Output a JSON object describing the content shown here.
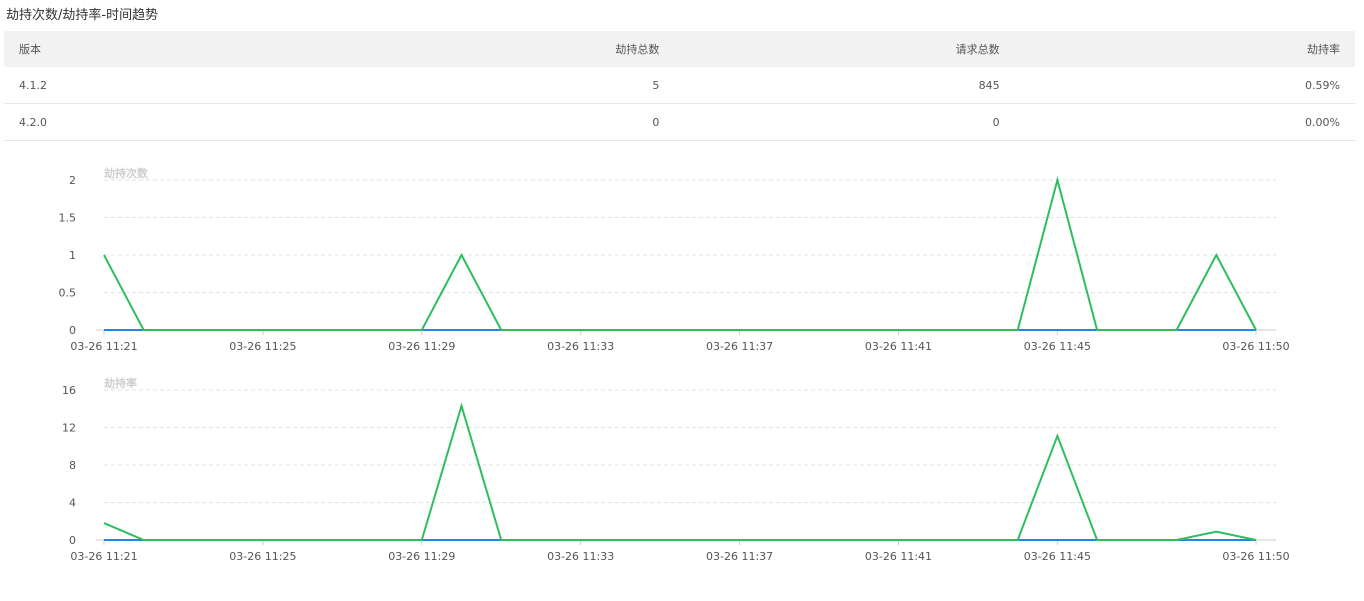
{
  "page": {
    "title": "劫持次数/劫持率-时间趋势"
  },
  "table": {
    "headers": [
      "版本",
      "劫持总数",
      "请求总数",
      "劫持率"
    ],
    "rows": [
      [
        "4.1.2",
        "5",
        "845",
        "0.59%"
      ],
      [
        "4.2.0",
        "0",
        "0",
        "0.00%"
      ]
    ]
  },
  "colors": {
    "green": "#2dbe60",
    "blue": "#1e88e5",
    "grid": "#e0e0e0",
    "axis": "#cccccc"
  },
  "chart_data": [
    {
      "type": "line",
      "title": "劫持次数",
      "x": [
        "03-26 11:21",
        "03-26 11:22",
        "03-26 11:23",
        "03-26 11:24",
        "03-26 11:25",
        "03-26 11:26",
        "03-26 11:27",
        "03-26 11:28",
        "03-26 11:29",
        "03-26 11:30",
        "03-26 11:31",
        "03-26 11:32",
        "03-26 11:33",
        "03-26 11:34",
        "03-26 11:35",
        "03-26 11:36",
        "03-26 11:37",
        "03-26 11:38",
        "03-26 11:39",
        "03-26 11:40",
        "03-26 11:41",
        "03-26 11:42",
        "03-26 11:43",
        "03-26 11:44",
        "03-26 11:45",
        "03-26 11:46",
        "03-26 11:47",
        "03-26 11:48",
        "03-26 11:49",
        "03-26 11:50"
      ],
      "x_ticks": [
        "03-26 11:21",
        "03-26 11:25",
        "03-26 11:29",
        "03-26 11:33",
        "03-26 11:37",
        "03-26 11:41",
        "03-26 11:45",
        "03-26 11:50"
      ],
      "y_ticks": [
        "0",
        "0.5",
        "1",
        "1.5",
        "2"
      ],
      "ylim": [
        0,
        2
      ],
      "series": [
        {
          "color": "green",
          "values": [
            1,
            0,
            0,
            0,
            0,
            0,
            0,
            0,
            0,
            1,
            0,
            0,
            0,
            0,
            0,
            0,
            0,
            0,
            0,
            0,
            0,
            0,
            0,
            0,
            2,
            0,
            0,
            0,
            1,
            0
          ]
        },
        {
          "color": "blue",
          "values": [
            0,
            0,
            0,
            0,
            0,
            0,
            0,
            0,
            0,
            0,
            0,
            0,
            0,
            0,
            0,
            0,
            0,
            0,
            0,
            0,
            0,
            0,
            0,
            0,
            0,
            0,
            0,
            0,
            0,
            0
          ]
        }
      ],
      "grid": true
    },
    {
      "type": "line",
      "title": "劫持率",
      "x": [
        "03-26 11:21",
        "03-26 11:22",
        "03-26 11:23",
        "03-26 11:24",
        "03-26 11:25",
        "03-26 11:26",
        "03-26 11:27",
        "03-26 11:28",
        "03-26 11:29",
        "03-26 11:30",
        "03-26 11:31",
        "03-26 11:32",
        "03-26 11:33",
        "03-26 11:34",
        "03-26 11:35",
        "03-26 11:36",
        "03-26 11:37",
        "03-26 11:38",
        "03-26 11:39",
        "03-26 11:40",
        "03-26 11:41",
        "03-26 11:42",
        "03-26 11:43",
        "03-26 11:44",
        "03-26 11:45",
        "03-26 11:46",
        "03-26 11:47",
        "03-26 11:48",
        "03-26 11:49",
        "03-26 11:50"
      ],
      "x_ticks": [
        "03-26 11:21",
        "03-26 11:25",
        "03-26 11:29",
        "03-26 11:33",
        "03-26 11:37",
        "03-26 11:41",
        "03-26 11:45",
        "03-26 11:50"
      ],
      "y_ticks": [
        "0",
        "4",
        "8",
        "12",
        "16"
      ],
      "ylim": [
        0,
        16
      ],
      "series": [
        {
          "color": "green",
          "values": [
            1.8,
            0,
            0,
            0,
            0,
            0,
            0,
            0,
            0,
            14.3,
            0,
            0,
            0,
            0,
            0,
            0,
            0,
            0,
            0,
            0,
            0,
            0,
            0,
            0,
            11.1,
            0,
            0,
            0,
            0.9,
            0
          ]
        },
        {
          "color": "blue",
          "values": [
            0,
            0,
            0,
            0,
            0,
            0,
            0,
            0,
            0,
            0,
            0,
            0,
            0,
            0,
            0,
            0,
            0,
            0,
            0,
            0,
            0,
            0,
            0,
            0,
            0,
            0,
            0,
            0,
            0,
            0
          ]
        }
      ],
      "grid": true
    }
  ]
}
